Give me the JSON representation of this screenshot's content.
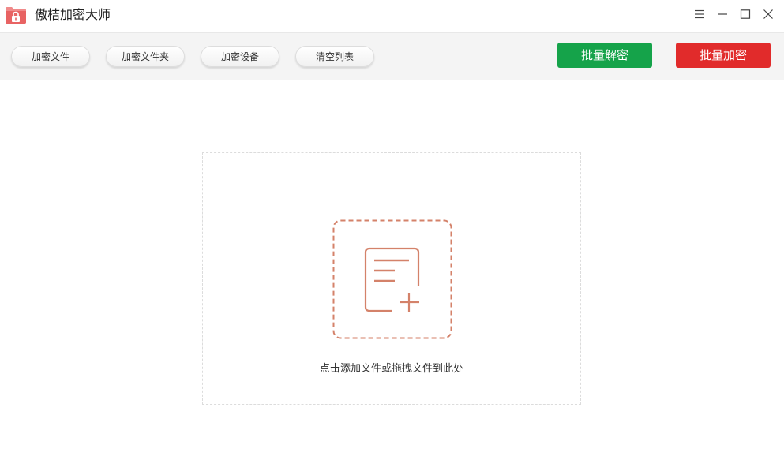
{
  "app": {
    "title": "傲桔加密大师",
    "logo_icon": "lock-folder-icon",
    "logo_color": "#e86f6f"
  },
  "window_controls": {
    "menu_icon": "hamburger-menu-icon",
    "minimize_icon": "minimize-icon",
    "maximize_icon": "maximize-icon",
    "close_icon": "close-icon"
  },
  "toolbar": {
    "encrypt_file_label": "加密文件",
    "encrypt_folder_label": "加密文件夹",
    "encrypt_device_label": "加密设备",
    "clear_list_label": "清空列表",
    "batch_decrypt_label": "批量解密",
    "batch_encrypt_label": "批量加密",
    "decrypt_color": "#15a34a",
    "encrypt_color": "#e12b2b"
  },
  "dropzone": {
    "icon": "add-file-icon",
    "hint": "点击添加文件或拖拽文件到此处",
    "accent_color": "#d4826a"
  }
}
